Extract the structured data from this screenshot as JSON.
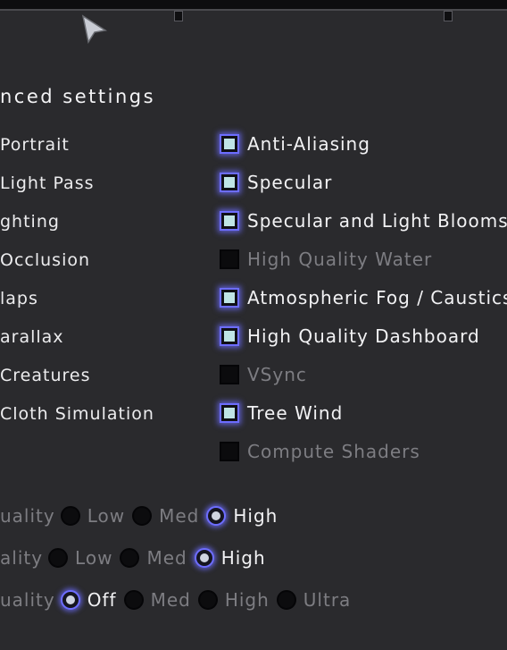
{
  "section_title": "nced settings",
  "left_options": [
    "Portrait",
    "Light Pass",
    "ghting",
    "Occlusion",
    "laps",
    "arallax",
    "Creatures",
    "Cloth Simulation"
  ],
  "checkboxes": [
    {
      "label": "Anti-Aliasing",
      "checked": true,
      "enabled": true
    },
    {
      "label": "Specular",
      "checked": true,
      "enabled": true
    },
    {
      "label": "Specular and Light Blooms",
      "checked": true,
      "enabled": true
    },
    {
      "label": "High Quality Water",
      "checked": false,
      "enabled": false
    },
    {
      "label": "Atmospheric Fog / Caustics",
      "checked": true,
      "enabled": true
    },
    {
      "label": "High Quality Dashboard",
      "checked": true,
      "enabled": true
    },
    {
      "label": "VSync",
      "checked": false,
      "enabled": false
    },
    {
      "label": "Tree Wind",
      "checked": true,
      "enabled": true
    },
    {
      "label": "Compute Shaders",
      "checked": false,
      "enabled": false
    }
  ],
  "quality_rows": [
    {
      "label": "uality",
      "options": [
        "Low",
        "Med",
        "High"
      ],
      "selected": "High"
    },
    {
      "label": "ality",
      "options": [
        "Low",
        "Med",
        "High"
      ],
      "selected": "High"
    },
    {
      "label": "uality",
      "options": [
        "Off",
        "Med",
        "High",
        "Ultra"
      ],
      "selected": "Off"
    }
  ],
  "colors": {
    "background": "#2a2a2d",
    "accent_glow": "#6d6dff",
    "check_fill": "#bfe4e6",
    "text": "#f2f2f4",
    "text_dim": "#7d7d82"
  }
}
